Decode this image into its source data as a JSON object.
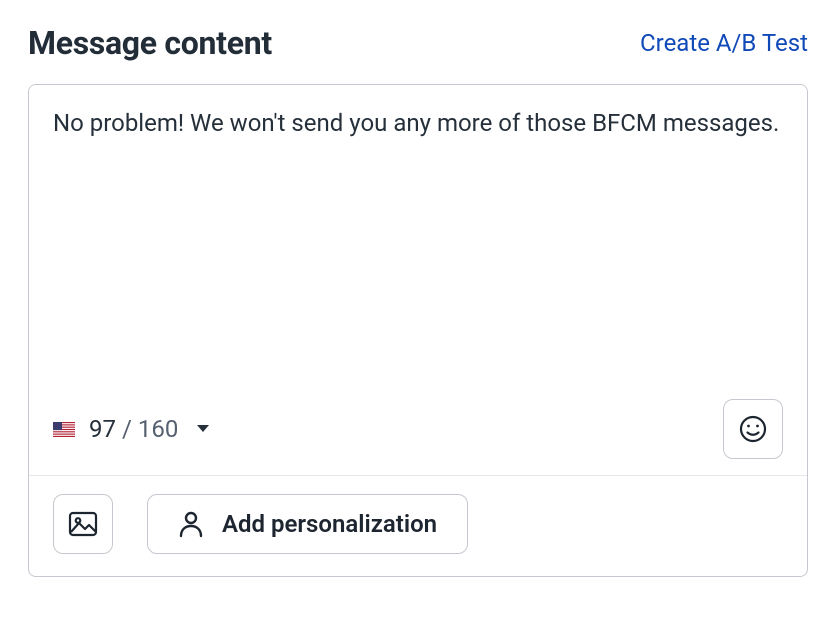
{
  "header": {
    "title": "Message content",
    "ab_test_link": "Create A/B Test"
  },
  "editor": {
    "message_text": "No problem! We won't send you any more of those BFCM messages.",
    "char_count": "97",
    "char_limit": "160",
    "flag_country": "US"
  },
  "toolbar": {
    "personalization_label": "Add personalization"
  }
}
